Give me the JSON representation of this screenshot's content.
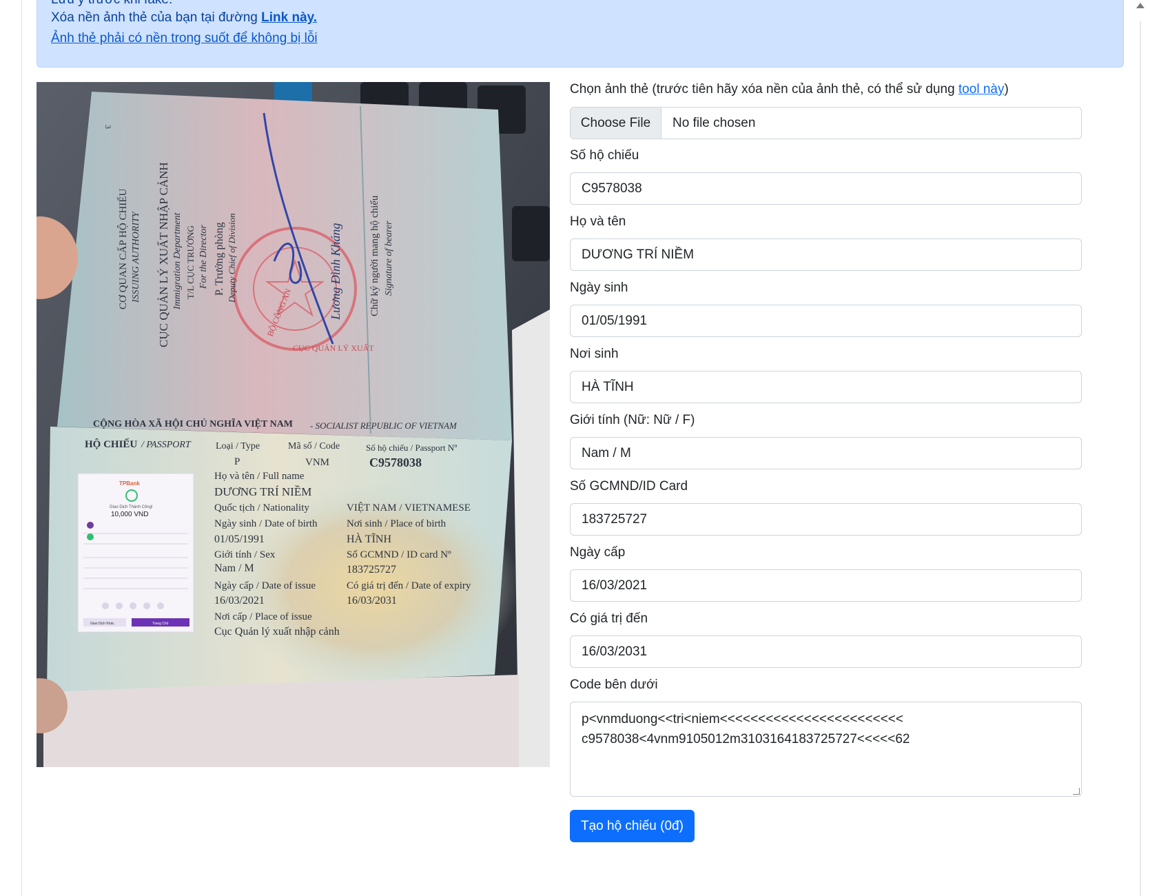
{
  "alert": {
    "line1": "Lưu ý trước khi fake:",
    "line2_prefix": "Xóa nền ảnh thẻ của bạn tại đường ",
    "line2_link": "Link này.",
    "line3_link": "Ảnh thẻ phải có nền trong suốt để không bị lỗi"
  },
  "passport": {
    "page_number": "3",
    "authority_vn": "CƠ QUAN CẤP HỘ CHIẾU",
    "authority_en": "ISSUING AUTHORITY",
    "department_vn": "CỤC QUẢN LÝ XUẤT NHẬP CẢNH",
    "department_en": "Immigration Department",
    "director_vn": "T/L CỤC TRƯỞNG",
    "director_en": "For the Director",
    "deputy_vn": "P. Trưởng phòng",
    "deputy_en": "Deputy Chief of Division",
    "signer": "Lương Đình Kháng",
    "bearer_vn": "Chữ ký người mang hộ chiếu",
    "bearer_en": "Signature of bearer",
    "stamp_top": "BỘ CÔNG AN",
    "stamp_bottom": "CỤC QUẢN LÝ XUẤT",
    "republic_vn": "CỘNG HÒA XÃ HỘI CHỦ NGHĨA VIỆT NAM",
    "republic_en": "- SOCIALIST REPUBLIC OF VIETNAM",
    "passport_vn": "HỘ CHIẾU",
    "passport_en": "/ PASSPORT",
    "type_label": "Loại / Type",
    "type_value": "P",
    "code_label": "Mã số / Code",
    "code_value": "VNM",
    "number_label": "Số hộ chiếu / Passport Nº",
    "number_value": "C9578038",
    "name_label": "Họ và tên / Full name",
    "name_value": "DƯƠNG TRÍ NIỀM",
    "nationality_label": "Quốc tịch / Nationality",
    "nationality_value": "VIỆT NAM / VIETNAMESE",
    "dob_label": "Ngày sinh / Date of birth",
    "dob_value": "01/05/1991",
    "pob_label": "Nơi sinh / Place of birth",
    "pob_value": "HÀ TĨNH",
    "sex_label": "Giới tính / Sex",
    "sex_value": "Nam / M",
    "id_label": "Số GCMND / ID card Nº",
    "id_value": "183725727",
    "issue_label": "Ngày cấp / Date of issue",
    "issue_value": "16/03/2021",
    "expiry_label": "Có giá trị đến / Date of expiry",
    "expiry_value": "16/03/2031",
    "place_label": "Nơi cấp / Place of issue",
    "place_value": "Cục Quản lý xuất nhập cảnh",
    "card": {
      "brand": "TPBank",
      "status": "Giao Dịch Thành Công!",
      "amount": "10,000 VND",
      "btn_left": "Giao Dịch Khác",
      "btn_right": "Trang Chủ"
    }
  },
  "form": {
    "photo_label_prefix": "Chọn ảnh thẻ (trước tiên hãy xóa nền của ảnh thẻ, có thể sử dụng ",
    "photo_label_link": "tool này",
    "photo_label_suffix": ")",
    "file_button": "Choose File",
    "file_status": "No file chosen",
    "fields": [
      {
        "label": "Số hộ chiếu",
        "value": "C9578038"
      },
      {
        "label": "Họ và tên",
        "value": "DƯƠNG TRÍ NIỀM"
      },
      {
        "label": "Ngày sinh",
        "value": "01/05/1991"
      },
      {
        "label": "Nơi sinh",
        "value": "HÀ TĨNH"
      },
      {
        "label": "Giới tính (Nữ: Nữ / F)",
        "value": "Nam / M"
      },
      {
        "label": "Số GCMND/ID Card",
        "value": "183725727"
      },
      {
        "label": "Ngày cấp",
        "value": "16/03/2021"
      },
      {
        "label": "Có giá trị đến",
        "value": "16/03/2031"
      }
    ],
    "mrz_label": "Code bên dưới",
    "mrz_line1": "p<vnmduong<<tri<niem<<<<<<<<<<<<<<<<<<<<<<<<",
    "mrz_line2": "c9578038<4vnm9105012m3103164183725727<<<<<62",
    "submit": "Tạo hộ chiếu (0đ)"
  }
}
